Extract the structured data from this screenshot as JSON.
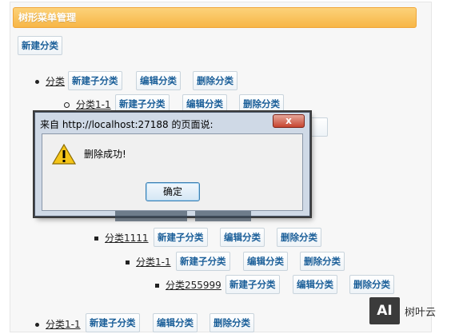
{
  "panel": {
    "title": "树形菜单管理",
    "new_category": "新建分类"
  },
  "actions": {
    "add_child": "新建子分类",
    "edit": "编辑分类",
    "delete": "删除分类"
  },
  "tree": [
    {
      "label": "分类"
    },
    {
      "label": "分类1-1"
    },
    {
      "label": "分类1111"
    },
    {
      "label": "分类1-1"
    },
    {
      "label": "分类255999"
    },
    {
      "label": "分类1-1"
    }
  ],
  "dialog": {
    "title": "来自 http://localhost:27188 的页面说:",
    "message": "删除成功!",
    "ok": "确定",
    "close": "x",
    "icon": "warning-icon"
  },
  "watermark": {
    "logo": "AI",
    "text": "树叶云"
  },
  "colors": {
    "header": "#f7b646",
    "button_text": "#1b5f99",
    "dialog_frame": "#cfd9e6"
  }
}
